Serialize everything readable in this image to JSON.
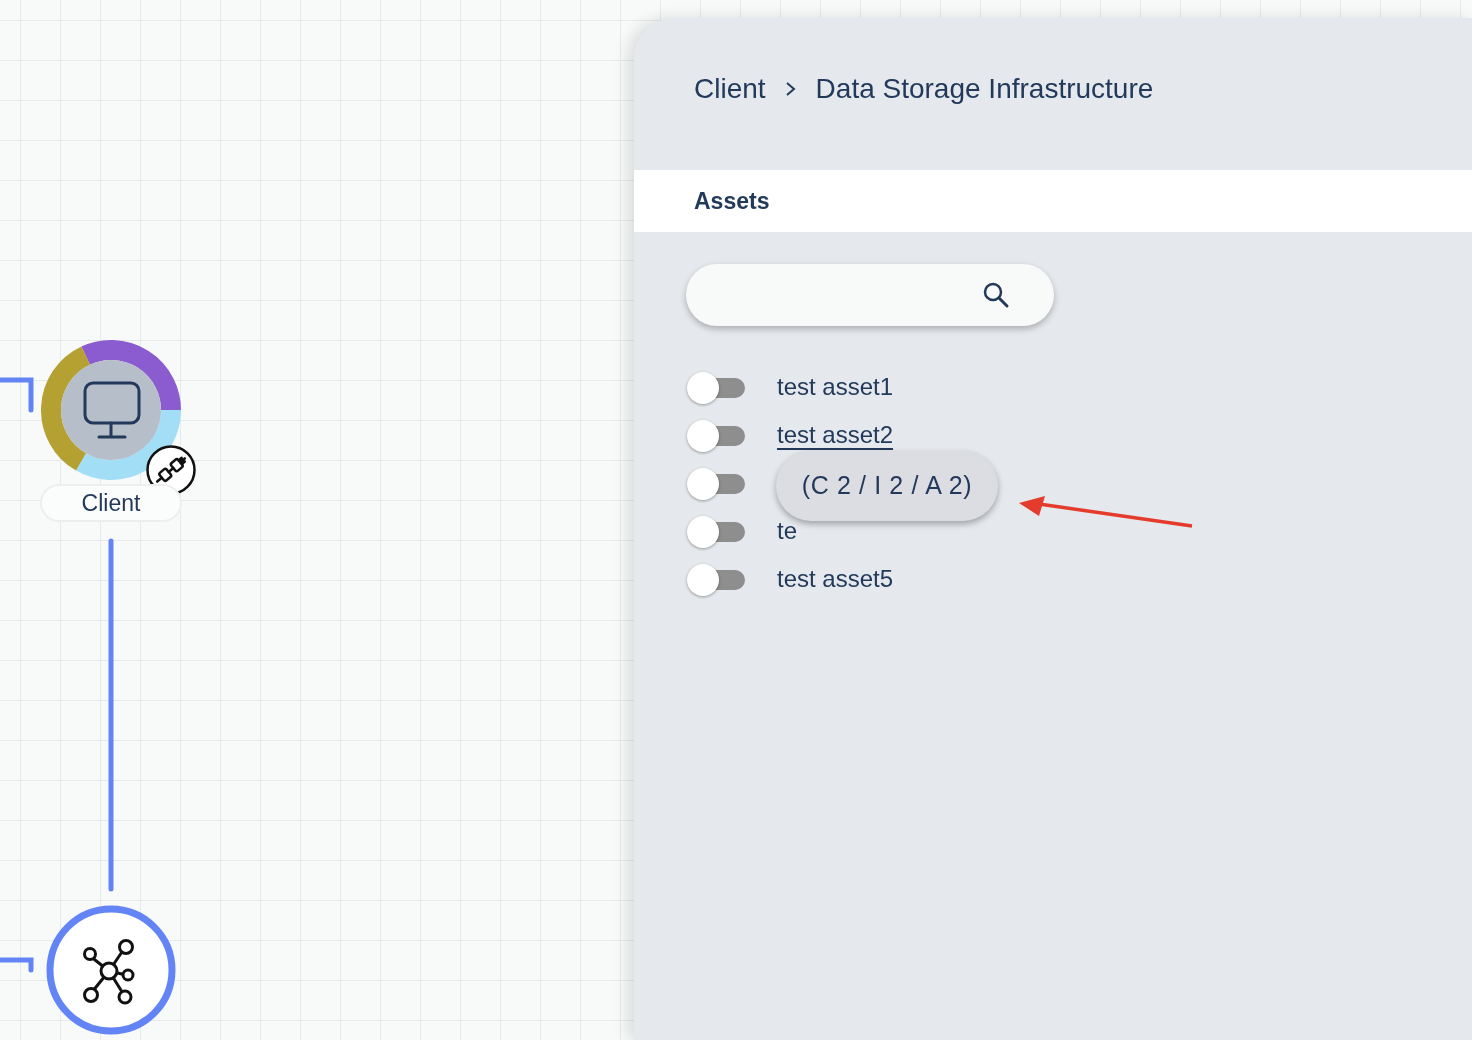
{
  "canvas": {
    "nodes": [
      {
        "kind": "client",
        "label": "Client",
        "ring": [
          {
            "color": "#8a5ccf"
          },
          {
            "color": "#a3def7"
          },
          {
            "color": "#b5a032"
          }
        ]
      },
      {
        "kind": "hub"
      }
    ]
  },
  "panel": {
    "breadcrumb": [
      "Client",
      "Data Storage Infrastructure"
    ],
    "tabs": [
      {
        "label": "Assets",
        "selected": true
      }
    ],
    "assets": [
      {
        "label": "test asset1",
        "on": false,
        "hovered": false
      },
      {
        "label": "test asset2",
        "on": false,
        "hovered": true
      },
      {
        "on": false
      },
      {
        "label": "te",
        "on": false,
        "hovered": false
      },
      {
        "label": "test asset5",
        "on": false,
        "hovered": false
      }
    ],
    "tooltip": "(C 2 / I 2 / A 2)"
  }
}
